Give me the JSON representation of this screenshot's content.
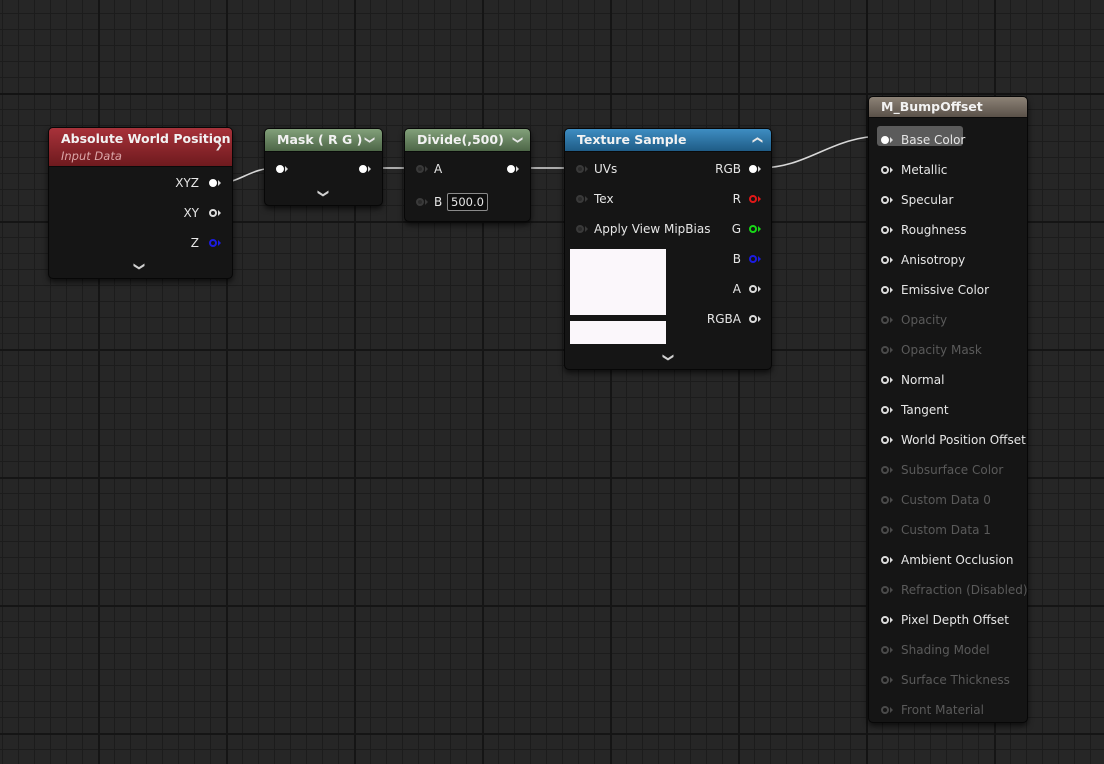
{
  "nodes": {
    "absolute_world_position": {
      "title": "Absolute World Position",
      "subtitle": "Input Data",
      "header_color": "#a8323a",
      "outputs": [
        "XYZ",
        "XY",
        "Z"
      ]
    },
    "mask": {
      "title": "Mask ( R G )",
      "header_color": "#82a07a"
    },
    "divide": {
      "title": "Divide(,500)",
      "header_color": "#82a07a",
      "input_a": "A",
      "input_b": "B",
      "b_value": "500.0"
    },
    "texture_sample": {
      "title": "Texture Sample",
      "header_color": "#3e8dc2",
      "inputs": [
        "UVs",
        "Tex",
        "Apply View MipBias"
      ],
      "outputs": [
        "RGB",
        "R",
        "G",
        "B",
        "A",
        "RGBA"
      ]
    },
    "material": {
      "title": "M_BumpOffset",
      "header_color": "#8c8276",
      "inputs": [
        {
          "label": "Base Color",
          "enabled": true
        },
        {
          "label": "Metallic",
          "enabled": true
        },
        {
          "label": "Specular",
          "enabled": true
        },
        {
          "label": "Roughness",
          "enabled": true
        },
        {
          "label": "Anisotropy",
          "enabled": true
        },
        {
          "label": "Emissive Color",
          "enabled": true
        },
        {
          "label": "Opacity",
          "enabled": false
        },
        {
          "label": "Opacity Mask",
          "enabled": false
        },
        {
          "label": "Normal",
          "enabled": true
        },
        {
          "label": "Tangent",
          "enabled": true
        },
        {
          "label": "World Position Offset",
          "enabled": true
        },
        {
          "label": "Subsurface Color",
          "enabled": false
        },
        {
          "label": "Custom Data 0",
          "enabled": false
        },
        {
          "label": "Custom Data 1",
          "enabled": false
        },
        {
          "label": "Ambient Occlusion",
          "enabled": true
        },
        {
          "label": "Refraction (Disabled)",
          "enabled": false
        },
        {
          "label": "Pixel Depth Offset",
          "enabled": true
        },
        {
          "label": "Shading Model",
          "enabled": false
        },
        {
          "label": "Surface Thickness",
          "enabled": false
        },
        {
          "label": "Front Material",
          "enabled": false
        }
      ]
    }
  },
  "colors": {
    "canvas": "#262626",
    "pin_red": "#e01818",
    "pin_green": "#18d818",
    "pin_blue": "#1c1ce0",
    "texture_preview": "#fbf7fb"
  },
  "icons": {
    "collapse": "chevron-down-icon",
    "collapse_up": "chevron-up-icon",
    "expand_pins": "chevron-down-icon"
  }
}
